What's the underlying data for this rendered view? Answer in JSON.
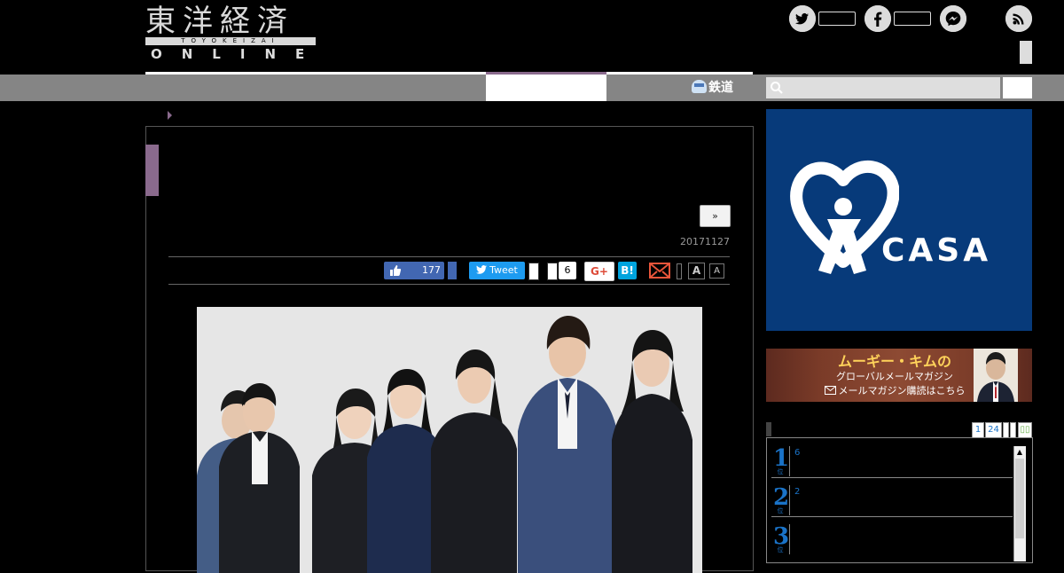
{
  "header": {
    "logo_kanji": "東洋経済",
    "logo_roman": "TOYOKEIZAI",
    "logo_online": "ONLINE",
    "social_icons": [
      "twitter-icon",
      "facebook-icon",
      "messenger-icon",
      "rss-icon"
    ]
  },
  "nav": {
    "rail_label": "鉄道",
    "search": {
      "placeholder": ""
    }
  },
  "article": {
    "next_label": "»",
    "date": "20171127",
    "share": {
      "fb_like_count": "177",
      "tweet_label": "Tweet",
      "pocket_count": "6",
      "gplus_label": "G+",
      "hatena_label": "B!",
      "font_large_label": "A",
      "font_small_label": "A"
    }
  },
  "sidebar": {
    "ad_casa": {
      "word": "CASA",
      "reg": "®"
    },
    "ad_mag": {
      "line1": "ムーギー・キムの",
      "line2": "グローバルメールマガジン",
      "line3": "メールマガジン購読はこちら"
    },
    "ranking": {
      "tabs": [
        "1",
        "24"
      ],
      "rows": [
        {
          "rank": "1",
          "sub": "位",
          "text": "6"
        },
        {
          "rank": "2",
          "sub": "位",
          "text": "2"
        },
        {
          "rank": "3",
          "sub": "位",
          "text": ""
        }
      ]
    }
  },
  "colors": {
    "accent": "#8a6a8d",
    "nav_bg": "#858585",
    "casa_blue": "#073a7a",
    "rank_blue": "#1a73c8",
    "facebook": "#4267b2",
    "twitter": "#1d9bf0",
    "hatena": "#00a4de"
  }
}
